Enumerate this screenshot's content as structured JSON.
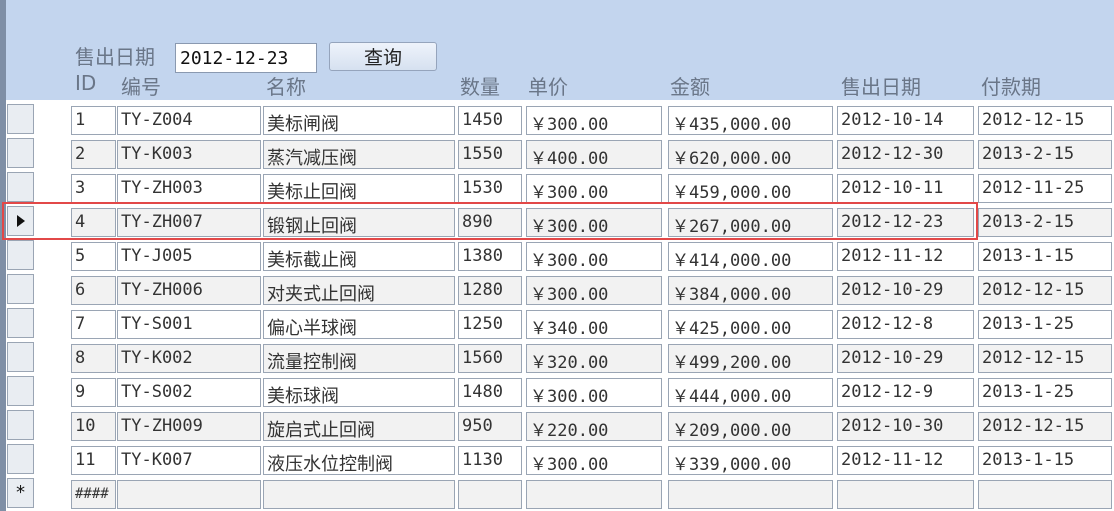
{
  "filter": {
    "label": "售出日期",
    "value": "2012-12-23",
    "button_label": "查询"
  },
  "columns": [
    "ID",
    "编号",
    "名称",
    "数量",
    "单价",
    "金额",
    "售出日期",
    "付款期"
  ],
  "rows": [
    [
      "1",
      "TY-Z004",
      "美标闸阀",
      "1450",
      "￥300.00",
      "￥435,000.00",
      "2012-10-14",
      "2012-12-15"
    ],
    [
      "2",
      "TY-K003",
      "蒸汽减压阀",
      "1550",
      "￥400.00",
      "￥620,000.00",
      "2012-12-30",
      "2013-2-15"
    ],
    [
      "3",
      "TY-ZH003",
      "美标止回阀",
      "1530",
      "￥300.00",
      "￥459,000.00",
      "2012-10-11",
      "2012-11-25"
    ],
    [
      "4",
      "TY-ZH007",
      "锻钢止回阀",
      "890",
      "￥300.00",
      "￥267,000.00",
      "2012-12-23",
      "2013-2-15"
    ],
    [
      "5",
      "TY-J005",
      "美标截止阀",
      "1380",
      "￥300.00",
      "￥414,000.00",
      "2012-11-12",
      "2013-1-15"
    ],
    [
      "6",
      "TY-ZH006",
      "对夹式止回阀",
      "1280",
      "￥300.00",
      "￥384,000.00",
      "2012-10-29",
      "2012-12-15"
    ],
    [
      "7",
      "TY-S001",
      "偏心半球阀",
      "1250",
      "￥340.00",
      "￥425,000.00",
      "2012-12-8",
      "2013-1-25"
    ],
    [
      "8",
      "TY-K002",
      "流量控制阀",
      "1560",
      "￥320.00",
      "￥499,200.00",
      "2012-10-29",
      "2012-12-15"
    ],
    [
      "9",
      "TY-S002",
      "美标球阀",
      "1480",
      "￥300.00",
      "￥444,000.00",
      "2012-12-9",
      "2013-1-25"
    ],
    [
      "10",
      "TY-ZH009",
      "旋启式止回阀",
      "950",
      "￥220.00",
      "￥209,000.00",
      "2012-10-30",
      "2012-12-15"
    ],
    [
      "11",
      "TY-K007",
      "液压水位控制阀",
      "1130",
      "￥300.00",
      "￥339,000.00",
      "2012-11-12",
      "2013-1-15"
    ]
  ],
  "new_record": {
    "selector_symbol": "*",
    "id_placeholder": "####"
  },
  "current_row": 4,
  "colors": {
    "header_bg": "#c3d5ee",
    "highlight": "#e24848"
  }
}
